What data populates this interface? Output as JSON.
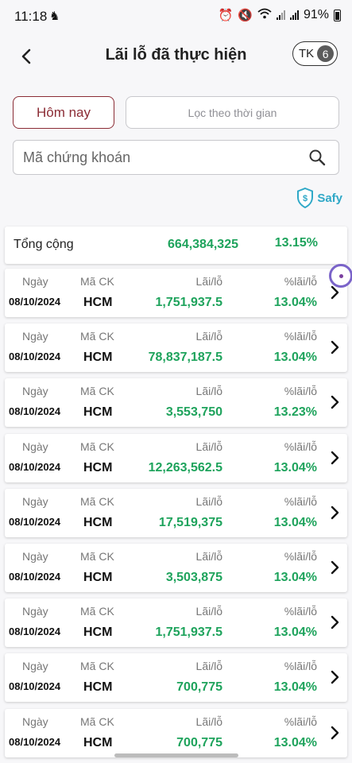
{
  "status_bar": {
    "time": "11:18",
    "battery": "91%"
  },
  "header": {
    "title": "Lãi lỗ đã thực hiện",
    "account_prefix": "TK",
    "account_number": "6"
  },
  "filters": {
    "today_label": "Hôm nay",
    "time_filter_label": "Lọc theo thời gian"
  },
  "search": {
    "placeholder": "Mã chứng khoán"
  },
  "safy": {
    "label": "Safy"
  },
  "total": {
    "label": "Tổng cộng",
    "value": "664,384,325",
    "percent": "13.15%"
  },
  "columns": {
    "date": "Ngày",
    "code": "Mã CK",
    "profit": "Lãi/lỗ",
    "percent": "%lãi/lỗ"
  },
  "rows": [
    {
      "date": "08/10/2024",
      "code": "HCM",
      "profit": "1,751,937.5",
      "percent": "13.04%"
    },
    {
      "date": "08/10/2024",
      "code": "HCM",
      "profit": "78,837,187.5",
      "percent": "13.04%"
    },
    {
      "date": "08/10/2024",
      "code": "HCM",
      "profit": "3,553,750",
      "percent": "13.23%"
    },
    {
      "date": "08/10/2024",
      "code": "HCM",
      "profit": "12,263,562.5",
      "percent": "13.04%"
    },
    {
      "date": "08/10/2024",
      "code": "HCM",
      "profit": "17,519,375",
      "percent": "13.04%"
    },
    {
      "date": "08/10/2024",
      "code": "HCM",
      "profit": "3,503,875",
      "percent": "13.04%"
    },
    {
      "date": "08/10/2024",
      "code": "HCM",
      "profit": "1,751,937.5",
      "percent": "13.04%"
    },
    {
      "date": "08/10/2024",
      "code": "HCM",
      "profit": "700,775",
      "percent": "13.04%"
    },
    {
      "date": "08/10/2024",
      "code": "HCM",
      "profit": "700,775",
      "percent": "13.04%"
    }
  ],
  "colors": {
    "accent": "#8b2c35",
    "positive": "#1ea35c",
    "safy": "#2fa8c7"
  },
  "icons": {
    "back": "chevron-left-icon",
    "search": "search-icon",
    "safy": "shield-dollar-icon",
    "row_action": "chevron-right-icon"
  }
}
